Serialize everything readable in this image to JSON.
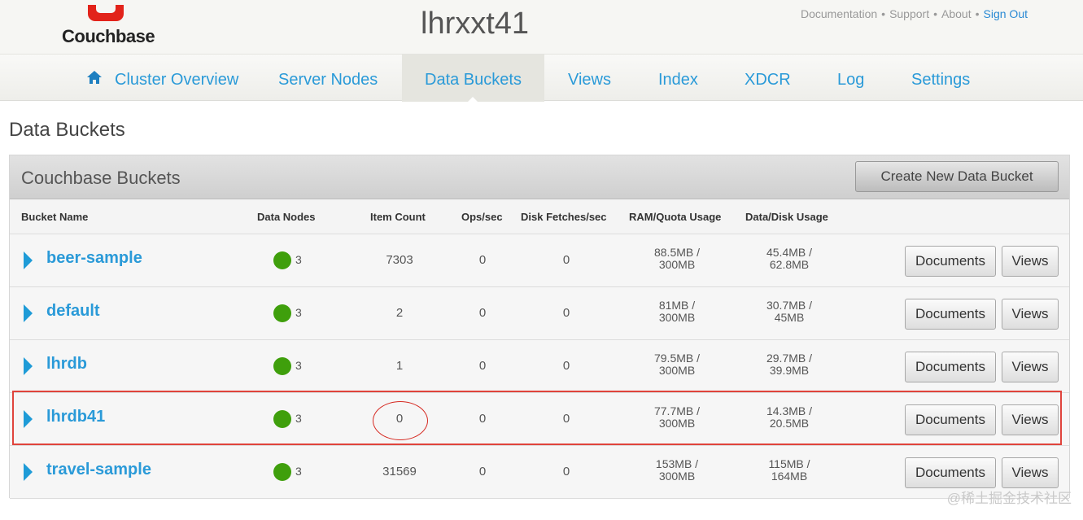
{
  "header": {
    "logo_text": "Couchbase",
    "cluster_name": "lhrxxt41",
    "links": [
      "Documentation",
      "Support",
      "About"
    ],
    "separator": "•",
    "sign_out": "Sign Out"
  },
  "nav": {
    "items": [
      "Cluster Overview",
      "Server Nodes",
      "Data Buckets",
      "Views",
      "Index",
      "XDCR",
      "Log",
      "Settings"
    ],
    "active": "Data Buckets"
  },
  "page_title": "Data Buckets",
  "panel": {
    "title": "Couchbase Buckets",
    "create_button": "Create New Data Bucket",
    "columns": [
      "Bucket Name",
      "Data Nodes",
      "Item Count",
      "Ops/sec",
      "Disk Fetches/sec",
      "RAM/Quota Usage",
      "Data/Disk Usage"
    ],
    "buckets": [
      {
        "name": "beer-sample",
        "nodes": "3",
        "items": "7303",
        "ops": "0",
        "fetches": "0",
        "ram_used": "88.5MB /",
        "ram_quota": "300MB",
        "data_used": "45.4MB /",
        "disk_used": "62.8MB",
        "documents": "Documents",
        "views": "Views"
      },
      {
        "name": "default",
        "nodes": "3",
        "items": "2",
        "ops": "0",
        "fetches": "0",
        "ram_used": "81MB /",
        "ram_quota": "300MB",
        "data_used": "30.7MB /",
        "disk_used": "45MB",
        "documents": "Documents",
        "views": "Views"
      },
      {
        "name": "lhrdb",
        "nodes": "3",
        "items": "1",
        "ops": "0",
        "fetches": "0",
        "ram_used": "79.5MB /",
        "ram_quota": "300MB",
        "data_used": "29.7MB /",
        "disk_used": "39.9MB",
        "documents": "Documents",
        "views": "Views"
      },
      {
        "name": "lhrdb41",
        "nodes": "3",
        "items": "0",
        "ops": "0",
        "fetches": "0",
        "ram_used": "77.7MB /",
        "ram_quota": "300MB",
        "data_used": "14.3MB /",
        "disk_used": "20.5MB",
        "documents": "Documents",
        "views": "Views"
      },
      {
        "name": "travel-sample",
        "nodes": "3",
        "items": "31569",
        "ops": "0",
        "fetches": "0",
        "ram_used": "153MB /",
        "ram_quota": "300MB",
        "data_used": "115MB /",
        "disk_used": "164MB",
        "documents": "Documents",
        "views": "Views"
      }
    ]
  },
  "colors": {
    "link_blue": "#2a9ad8",
    "node_ok_green": "#3f9f0c",
    "highlight_red": "#e0443c",
    "logo_red": "#e2231a"
  },
  "icons": {
    "home": "home-icon",
    "expand": "triangle-right-icon",
    "status": "green-dot-icon"
  },
  "watermark": "@稀土掘金技术社区"
}
